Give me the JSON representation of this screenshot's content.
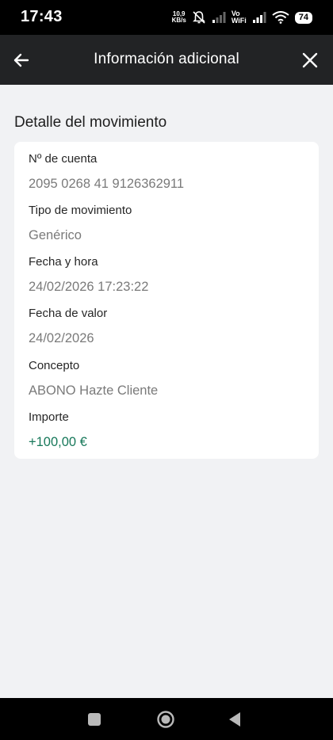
{
  "status_bar": {
    "time": "17:43",
    "speed_value": "10,9",
    "speed_unit": "KB/s",
    "vo_label": "Vo",
    "wifi_label": "WiFi",
    "battery": "74"
  },
  "header": {
    "title": "Información adicional",
    "back_icon": "arrow-left-icon",
    "close_icon": "close-icon"
  },
  "section_title": "Detalle del movimiento",
  "details": [
    {
      "label": "Nº de cuenta",
      "value": "2095 0268 41 9126362911"
    },
    {
      "label": "Tipo de movimiento",
      "value": "Genérico"
    },
    {
      "label": "Fecha y hora",
      "value": "24/02/2026 17:23:22"
    },
    {
      "label": "Fecha de valor",
      "value": "24/02/2026"
    },
    {
      "label": "Concepto",
      "value": "ABONO Hazte Cliente"
    },
    {
      "label": "Importe",
      "value": "+100,00 €"
    }
  ],
  "colors": {
    "amount": "#17785a",
    "header_bg": "#222325",
    "page_bg": "#f1f2f4"
  },
  "nav_bar": {
    "recents_icon": "square-icon",
    "home_icon": "circle-icon",
    "back_icon": "triangle-back-icon"
  }
}
